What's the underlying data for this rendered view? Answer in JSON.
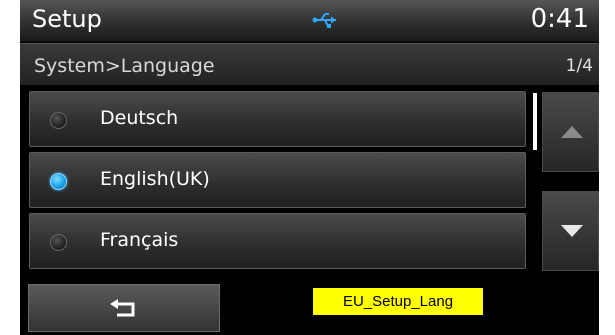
{
  "header": {
    "title": "Setup",
    "clock": "0:41",
    "status_icon": "usb-icon"
  },
  "path_bar": {
    "breadcrumb": "System>Language",
    "page_indicator": "1/4"
  },
  "language_list": {
    "items": [
      {
        "label": "Deutsch",
        "selected": false
      },
      {
        "label": "English(UK)",
        "selected": true
      },
      {
        "label": "Français",
        "selected": false
      }
    ]
  },
  "scroll": {
    "up_icon": "triangle-up-icon",
    "down_icon": "triangle-down-icon"
  },
  "footer": {
    "back_icon": "return-arrow-icon",
    "tag_label": "EU_Setup_Lang"
  },
  "colors": {
    "selected_radio": "#1aa3e8",
    "tag_background": "#ffff00"
  }
}
